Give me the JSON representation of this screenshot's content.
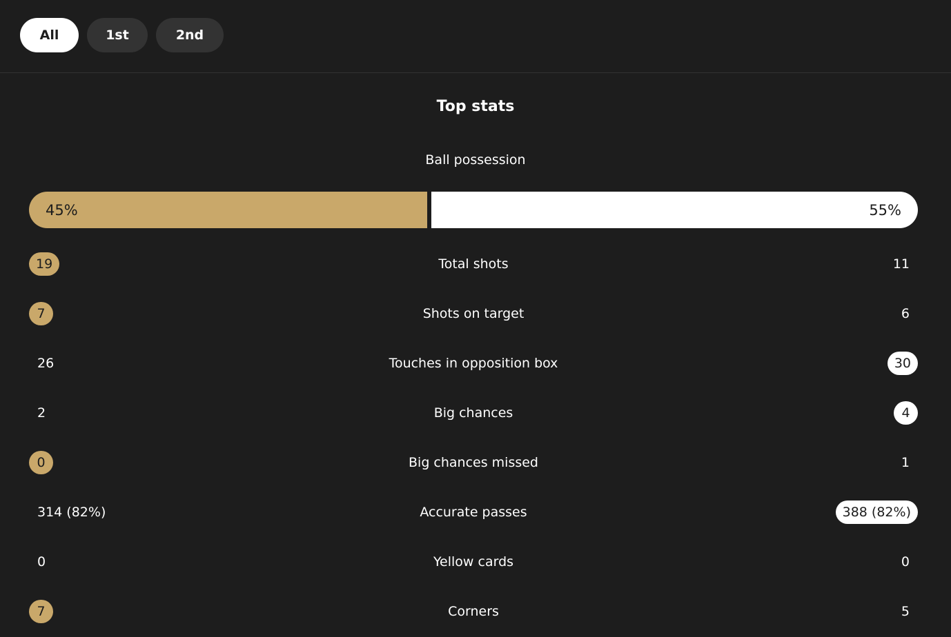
{
  "tabs": {
    "all": "All",
    "first": "1st",
    "second": "2nd"
  },
  "section_title": "Top stats",
  "possession": {
    "label": "Ball possession",
    "home": "45%",
    "away": "55%",
    "home_fraction": 0.45,
    "home_color": "#c9a86a",
    "away_color": "#ffffff"
  },
  "stats": [
    {
      "label": "Total shots",
      "home": "19",
      "away": "11",
      "highlight": "home"
    },
    {
      "label": "Shots on target",
      "home": "7",
      "away": "6",
      "highlight": "home"
    },
    {
      "label": "Touches in opposition box",
      "home": "26",
      "away": "30",
      "highlight": "away"
    },
    {
      "label": "Big chances",
      "home": "2",
      "away": "4",
      "highlight": "away"
    },
    {
      "label": "Big chances missed",
      "home": "0",
      "away": "1",
      "highlight": "home"
    },
    {
      "label": "Accurate passes",
      "home": "314 (82%)",
      "away": "388 (82%)",
      "highlight": "away"
    },
    {
      "label": "Yellow cards",
      "home": "0",
      "away": "0",
      "highlight": "none"
    },
    {
      "label": "Corners",
      "home": "7",
      "away": "5",
      "highlight": "home"
    }
  ]
}
